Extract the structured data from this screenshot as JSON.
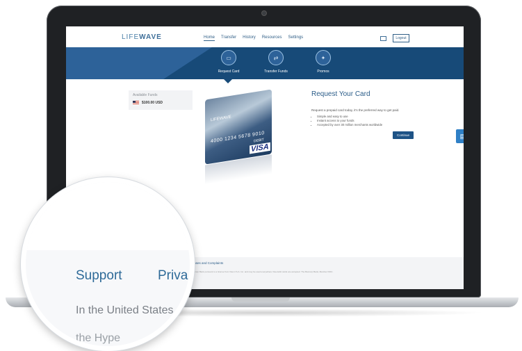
{
  "nav": {
    "logo_prefix": "LIFE",
    "logo_suffix": "WAVE",
    "items": [
      {
        "label": "Home"
      },
      {
        "label": "Transfer"
      },
      {
        "label": "History"
      },
      {
        "label": "Resources"
      },
      {
        "label": "Settings"
      }
    ],
    "logout_label": "Logout"
  },
  "tabs": [
    {
      "label": "Request Card",
      "icon": "card-icon"
    },
    {
      "label": "Transfer Funds",
      "icon": "transfer-icon"
    },
    {
      "label": "Promos",
      "icon": "gift-icon"
    }
  ],
  "funds": {
    "label": "Available Funds",
    "value": "$100.00 USD"
  },
  "card": {
    "brand": "LIFEWAVE",
    "number": "4000 1234 5678 9010",
    "type": "DEBIT",
    "network": "VISA"
  },
  "request": {
    "title": "Request Your Card",
    "description": "Request a prepaid card today, it's the preferred way to get paid.",
    "bullets": [
      "Simple and easy to use",
      "Instant access to your funds",
      "Accepted by over 30 million merchants worldwide"
    ],
    "continue_label": "Continue"
  },
  "footer": {
    "links": "Licenses and Complaints",
    "legal": "The Bancorp Bank pursuant to a license from Visa U.S.A. Inc. and may be used everywhere Visa debit cards are accepted. The Bancorp Bank; Member FDIC."
  },
  "magnifier": {
    "support": "Support",
    "privacy": "Priva",
    "us": "In the United States",
    "hype": "the Hype"
  },
  "colors": {
    "brand_blue": "#174a78",
    "accent_blue": "#2d6299",
    "link_blue": "#2a5c88"
  }
}
